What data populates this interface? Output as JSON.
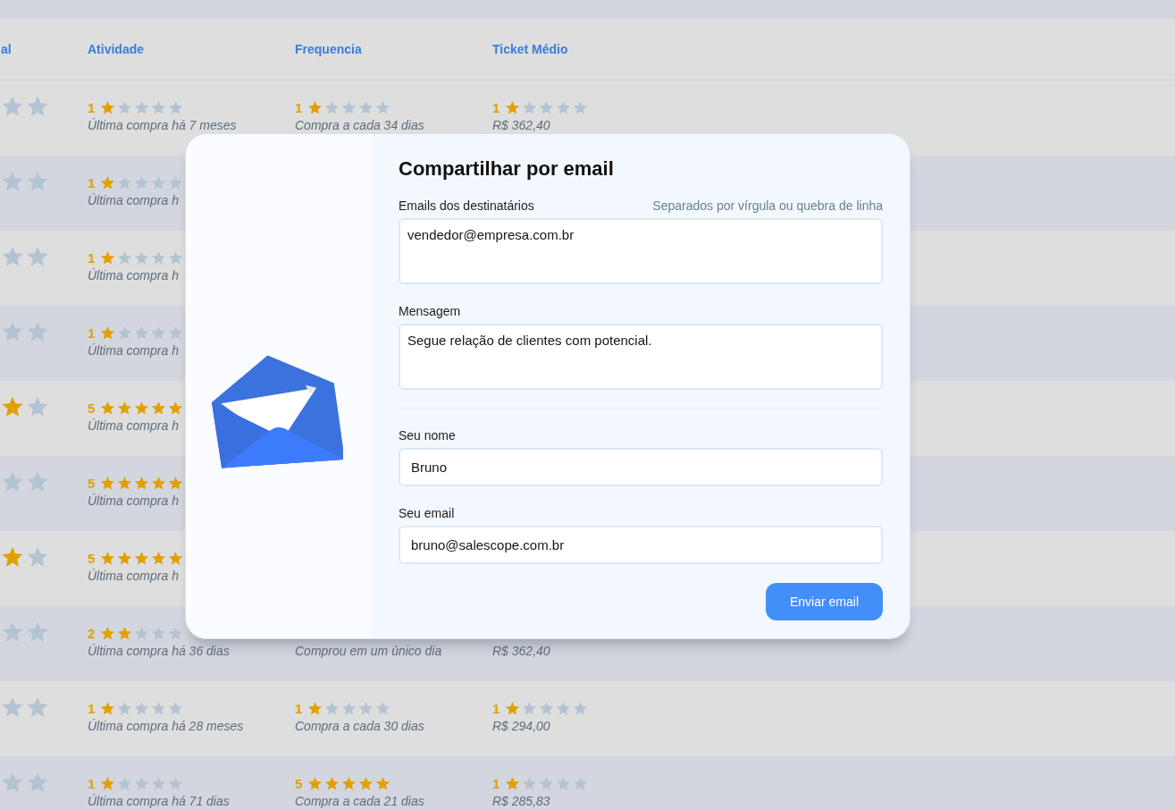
{
  "table": {
    "columns": [
      {
        "label": "al"
      },
      {
        "label": "Atividade"
      },
      {
        "label": "Frequencia"
      },
      {
        "label": "Ticket Médio"
      }
    ],
    "rows": [
      {
        "cells": [
          {
            "kind": "stars",
            "shown_stars": [
              {
                "filled": false
              },
              {
                "filled": false
              }
            ]
          },
          {
            "kind": "rating",
            "score": "1",
            "stars": 1,
            "note": "Última compra há 7 meses"
          },
          {
            "kind": "rating",
            "score": "1",
            "stars": 1,
            "note": "Compra a cada 34 dias"
          },
          {
            "kind": "rating",
            "score": "1",
            "stars": 1,
            "note": "R$ 362,40"
          }
        ]
      },
      {
        "cells": [
          {
            "kind": "stars",
            "shown_stars": [
              {
                "filled": false
              },
              {
                "filled": false
              }
            ]
          },
          {
            "kind": "rating",
            "score": "1",
            "stars": 1,
            "note": "Última compra h"
          }
        ]
      },
      {
        "cells": [
          {
            "kind": "stars",
            "shown_stars": [
              {
                "filled": false
              },
              {
                "filled": false
              }
            ]
          },
          {
            "kind": "rating",
            "score": "1",
            "stars": 1,
            "note": "Última compra h"
          }
        ]
      },
      {
        "cells": [
          {
            "kind": "stars",
            "shown_stars": [
              {
                "filled": false
              },
              {
                "filled": false
              }
            ]
          },
          {
            "kind": "rating",
            "score": "1",
            "stars": 1,
            "note": "Última compra h"
          }
        ]
      },
      {
        "cells": [
          {
            "kind": "stars",
            "shown_stars": [
              {
                "filled": true
              },
              {
                "filled": false
              }
            ]
          },
          {
            "kind": "rating",
            "score": "5",
            "stars": 5,
            "note": "Última compra h"
          }
        ]
      },
      {
        "cells": [
          {
            "kind": "stars",
            "shown_stars": [
              {
                "filled": false
              },
              {
                "filled": false
              }
            ]
          },
          {
            "kind": "rating",
            "score": "5",
            "stars": 5,
            "note": "Última compra h"
          }
        ]
      },
      {
        "cells": [
          {
            "kind": "stars",
            "shown_stars": [
              {
                "filled": true
              },
              {
                "filled": false
              }
            ]
          },
          {
            "kind": "rating",
            "score": "5",
            "stars": 5,
            "note": "Última compra h"
          }
        ]
      },
      {
        "cells": [
          {
            "kind": "stars",
            "shown_stars": [
              {
                "filled": false
              },
              {
                "filled": false
              }
            ]
          },
          {
            "kind": "rating",
            "score": "2",
            "stars": 2,
            "note": "Última compra há 36 dias"
          },
          {
            "kind": "note",
            "note": "Comprou em um único dia"
          },
          {
            "kind": "note",
            "note": "R$ 362,40"
          }
        ]
      },
      {
        "cells": [
          {
            "kind": "stars",
            "shown_stars": [
              {
                "filled": false
              },
              {
                "filled": false
              }
            ]
          },
          {
            "kind": "rating",
            "score": "1",
            "stars": 1,
            "note": "Última compra há 28 meses"
          },
          {
            "kind": "rating",
            "score": "1",
            "stars": 1,
            "note": "Compra a cada 30 dias"
          },
          {
            "kind": "rating",
            "score": "1",
            "stars": 1,
            "note": "R$ 294,00"
          }
        ]
      },
      {
        "cells": [
          {
            "kind": "stars",
            "shown_stars": [
              {
                "filled": false
              },
              {
                "filled": false
              }
            ]
          },
          {
            "kind": "rating",
            "score": "1",
            "stars": 1,
            "note": "Última compra há 71 dias"
          },
          {
            "kind": "rating",
            "score": "5",
            "stars": 5,
            "note": "Compra a cada 21 dias"
          },
          {
            "kind": "rating",
            "score": "1",
            "stars": 1,
            "note": "R$ 285,83"
          }
        ]
      }
    ]
  },
  "dialog": {
    "title": "Compartilhar por email",
    "fields": [
      {
        "kind": "textarea",
        "label": "Emails dos destinatários",
        "hint": "Separados por vírgula ou quebra de linha",
        "value": "vendedor@empresa.com.br"
      },
      {
        "kind": "textarea",
        "label": "Mensagem",
        "value": "Segue relação de clientes com potencial."
      },
      {
        "kind": "input",
        "label": "Seu nome",
        "value": "Bruno"
      },
      {
        "kind": "input",
        "label": "Seu email",
        "value": "bruno@salescope.com.br"
      }
    ],
    "submit": "Enviar email"
  }
}
